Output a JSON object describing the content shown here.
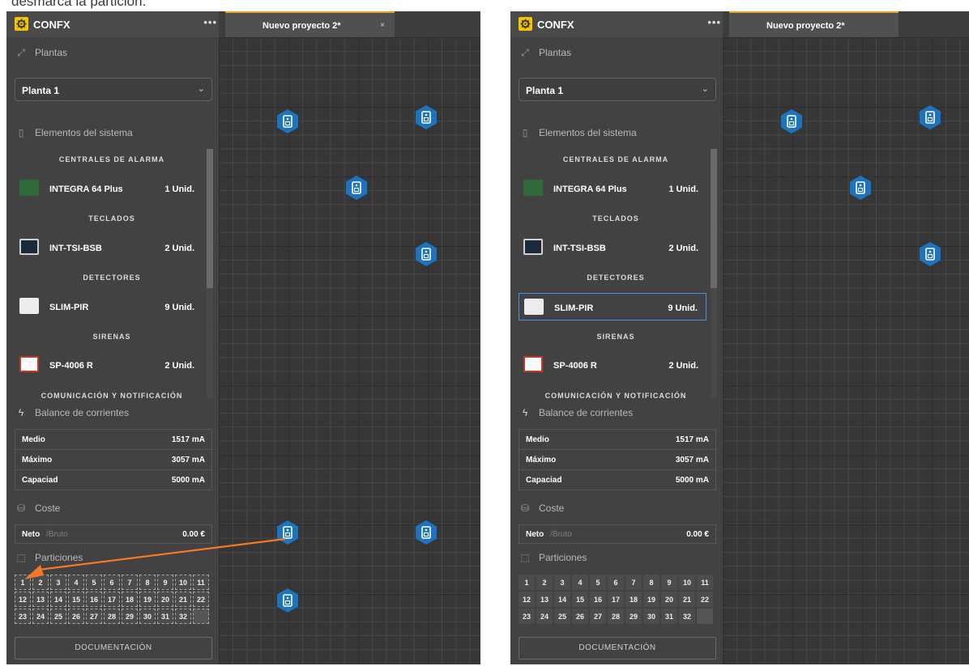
{
  "caption": "desmarca la partición.",
  "shots": [
    {
      "app": {
        "name": "CONFX",
        "menu_icon": "more-dots-icon",
        "logo_icon": "gear-icon"
      },
      "tab": {
        "label": "Nuevo proyecto 2*",
        "close": "×"
      },
      "plantas": {
        "title": "Plantas",
        "selected": "Planta 1"
      },
      "elementos": {
        "title": "Elementos del sistema",
        "categories": [
          "CENTRALES DE ALARMA",
          "TECLADOS",
          "DETECTORES",
          "SIRENAS",
          "COMUNICACIÓN Y NOTIFICACIÓN"
        ],
        "items": [
          {
            "name": "INTEGRA 64 Plus",
            "qty": "1 Unid."
          },
          {
            "name": "INT-TSI-BSB",
            "qty": "2 Unid."
          },
          {
            "name": "SLIM-PIR",
            "qty": "9 Unid."
          },
          {
            "name": "SP-4006 R",
            "qty": "2 Unid."
          }
        ]
      },
      "balance": {
        "title": "Balance de corrientes",
        "rows": [
          {
            "label": "Medio",
            "value": "1517 mA"
          },
          {
            "label": "Máximo",
            "value": "3057 mA"
          },
          {
            "label": "Capaciad",
            "value": "5000 mA"
          }
        ]
      },
      "coste": {
        "title": "Coste",
        "neto": "Neto",
        "bruto": "/Bruto",
        "amount": "0.00 €"
      },
      "particiones": {
        "title": "Particiones",
        "numbers": [
          "1",
          "2",
          "3",
          "4",
          "5",
          "6",
          "7",
          "8",
          "9",
          "10",
          "11",
          "12",
          "13",
          "14",
          "15",
          "16",
          "17",
          "18",
          "19",
          "20",
          "21",
          "22",
          "23",
          "24",
          "25",
          "26",
          "27",
          "28",
          "29",
          "30",
          "31",
          "32"
        ]
      },
      "doc_button": "DOCUMENTACIÓN",
      "annotation": {
        "color": "#f07a2a"
      }
    },
    {
      "app": {
        "name": "CONFX",
        "menu_icon": "more-dots-icon",
        "logo_icon": "gear-icon"
      },
      "tab": {
        "label": "Nuevo proyecto 2*"
      },
      "plantas": {
        "title": "Plantas",
        "selected": "Planta 1"
      },
      "elementos": {
        "title": "Elementos del sistema",
        "categories": [
          "CENTRALES DE ALARMA",
          "TECLADOS",
          "DETECTORES",
          "SIRENAS",
          "COMUNICACIÓN Y NOTIFICACIÓN"
        ],
        "items": [
          {
            "name": "INTEGRA 64 Plus",
            "qty": "1 Unid."
          },
          {
            "name": "INT-TSI-BSB",
            "qty": "2 Unid."
          },
          {
            "name": "SLIM-PIR",
            "qty": "9 Unid."
          },
          {
            "name": "SP-4006 R",
            "qty": "2 Unid."
          }
        ]
      },
      "balance": {
        "title": "Balance de corrientes",
        "rows": [
          {
            "label": "Medio",
            "value": "1517 mA"
          },
          {
            "label": "Máximo",
            "value": "3057 mA"
          },
          {
            "label": "Capaciad",
            "value": "5000 mA"
          }
        ]
      },
      "coste": {
        "title": "Coste",
        "neto": "Neto",
        "bruto": "/Bruto",
        "amount": "0.00 €"
      },
      "particiones": {
        "title": "Particiones",
        "numbers": [
          "1",
          "2",
          "3",
          "4",
          "5",
          "6",
          "7",
          "8",
          "9",
          "10",
          "11",
          "12",
          "13",
          "14",
          "15",
          "16",
          "17",
          "18",
          "19",
          "20",
          "21",
          "22",
          "23",
          "24",
          "25",
          "26",
          "27",
          "28",
          "29",
          "30",
          "31",
          "32"
        ]
      },
      "doc_button": "DOCUMENTACIÓN"
    }
  ],
  "colors": {
    "marker": "#1e73be",
    "accent": "#f0a020",
    "selection": "#4a90d9"
  }
}
